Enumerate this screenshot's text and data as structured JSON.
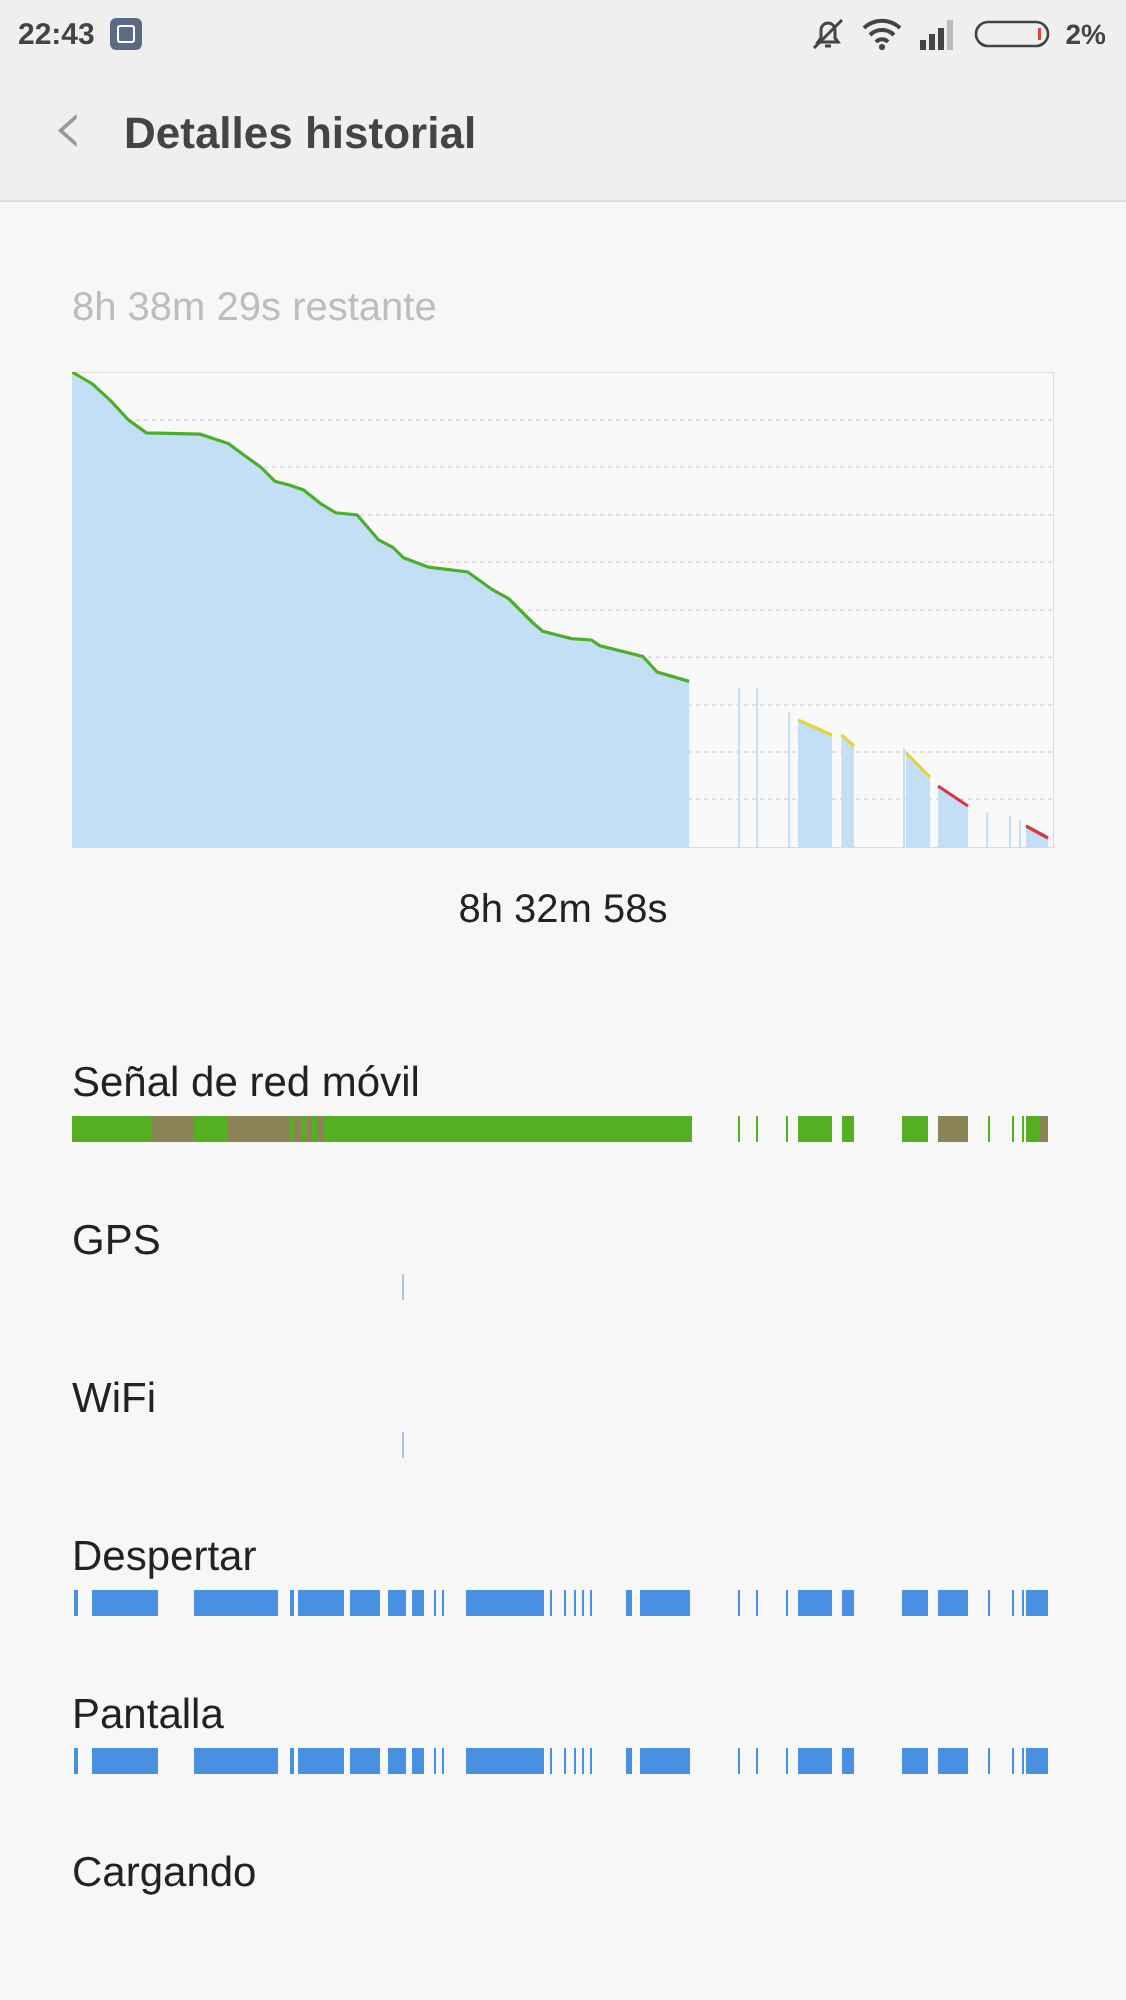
{
  "status_bar": {
    "time": "22:43",
    "battery": "2%"
  },
  "header": {
    "back": "‹",
    "title": "Detalles historial"
  },
  "remaining": "8h 38m 29s restante",
  "chart_caption": "8h 32m 58s",
  "rows": [
    {
      "label": "Señal de red móvil",
      "kind": "signal"
    },
    {
      "label": "GPS",
      "kind": "gps"
    },
    {
      "label": "WiFi",
      "kind": "wifi"
    },
    {
      "label": "Despertar",
      "kind": "wake"
    },
    {
      "label": "Pantalla",
      "kind": "screen"
    },
    {
      "label": "Cargando",
      "kind": "charging"
    }
  ]
}
